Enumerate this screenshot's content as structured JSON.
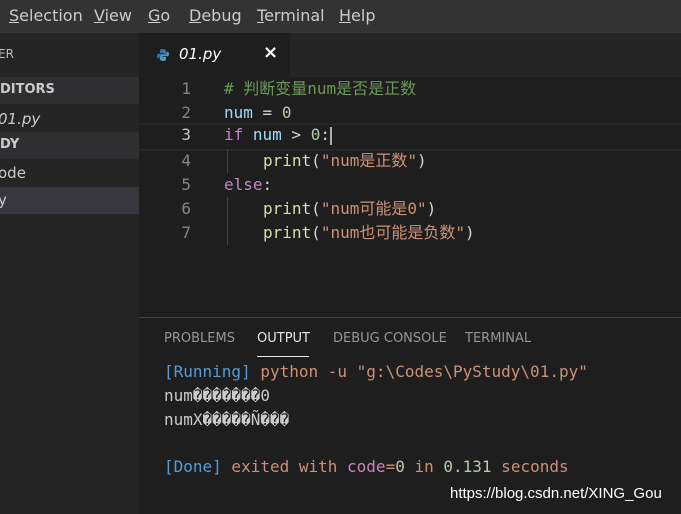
{
  "menubar": {
    "items": [
      {
        "mnemonic": "S",
        "rest": "election"
      },
      {
        "mnemonic": "V",
        "rest": "iew"
      },
      {
        "mnemonic": "G",
        "rest": "o"
      },
      {
        "mnemonic": "D",
        "rest": "ebug"
      },
      {
        "mnemonic": "T",
        "rest": "erminal"
      },
      {
        "mnemonic": "H",
        "rest": "elp"
      }
    ]
  },
  "sidebar": {
    "title": "ER",
    "open_editors_header": "DITORS",
    "open_file": "01.py",
    "folder_header": "DY",
    "item_folder": "ode",
    "item_file": "y"
  },
  "tab": {
    "label": "01.py",
    "close": "×",
    "icon": "python-icon"
  },
  "editor": {
    "line_numbers": [
      "1",
      "2",
      "3",
      "4",
      "5",
      "6",
      "7"
    ],
    "active_line": 3,
    "lines": {
      "l1": "# 判断变量num是否是正数",
      "l2_var": "num",
      "l2_op": " = ",
      "l2_num": "0",
      "l3_kw": "if",
      "l3_var": " num",
      "l3_op": " > ",
      "l3_num": "0",
      "l3_colon": ":",
      "l4_fn": "print",
      "l4_open": "(",
      "l4_str": "\"num是正数\"",
      "l4_close": ")",
      "l5_kw": "else",
      "l5_colon": ":",
      "l6_fn": "print",
      "l6_open": "(",
      "l6_str": "\"num可能是0\"",
      "l6_close": ")",
      "l7_fn": "print",
      "l7_open": "(",
      "l7_str": "\"num也可能是负数\"",
      "l7_close": ")"
    }
  },
  "panel": {
    "tabs": [
      "PROBLEMS",
      "OUTPUT",
      "DEBUG CONSOLE",
      "TERMINAL"
    ],
    "active_tab": "OUTPUT",
    "output": {
      "running_tag": "[Running]",
      "running_cmd": " python -u \"g:\\Codes\\PyStudy\\01.py\"",
      "garbled1": "num�������0",
      "garbled2": "numX�����Ñ���",
      "done_tag": "[Done]",
      "done_exited": " exited with ",
      "done_code_label": "code",
      "done_eq": "=",
      "done_code_val": "0",
      "done_in": " in ",
      "done_seconds_val": "0.131",
      "done_seconds": " seconds"
    }
  },
  "watermark": "https://blog.csdn.net/XING_Gou",
  "colors": {
    "background": "#1e1e1e",
    "sidebar": "#252526",
    "menubar": "#333333",
    "keyword": "#c586c0",
    "string": "#ce9178",
    "function": "#dcdcaa",
    "comment": "#6a9955"
  }
}
